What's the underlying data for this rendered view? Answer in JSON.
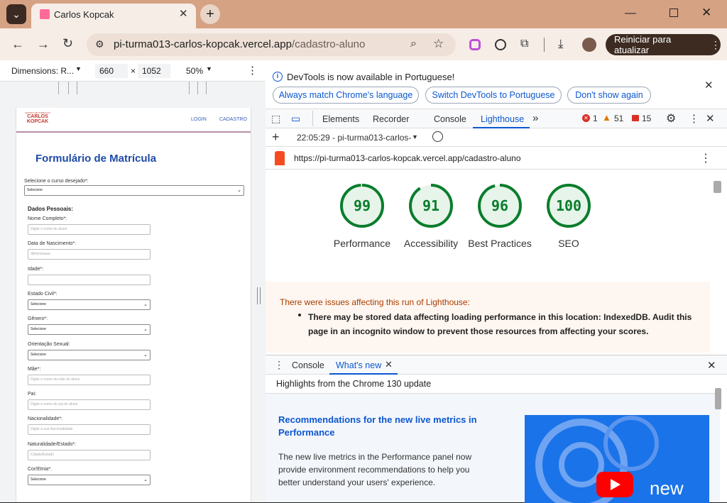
{
  "browser": {
    "tab_title": "Carlos Kopcak",
    "url_host": "pi-turma013-carlos-kopcak.vercel.app",
    "url_path": "/cadastro-aluno",
    "update_button": "Reiniciar para atualizar",
    "accent": "#d6a284"
  },
  "device_toolbar": {
    "dimensions_label": "Dimensions: R...",
    "width": "660",
    "times": "×",
    "height": "1052",
    "zoom": "50%"
  },
  "site": {
    "logo_line1": "CENTRO DE FORMAÇÃO",
    "logo_line2": "CARLOS",
    "logo_line3": "KOPCAK",
    "nav_login": "LOGIN",
    "nav_cadastro": "CADASTRO",
    "form_title": "Formulário de Matrícula",
    "course_label": "Selecione o curso desejado*:",
    "course_value": "Selecione",
    "section_title": "Dados Pessoais:",
    "fields": [
      {
        "label": "Nome Completo*:",
        "kind": "input",
        "value": "Digite o nome do aluno"
      },
      {
        "label": "Data de Nascimento*:",
        "kind": "input",
        "value": "dd/mm/aaaa"
      },
      {
        "label": "Idade*:",
        "kind": "input",
        "value": ""
      },
      {
        "label": "Estado Civil*:",
        "kind": "select",
        "value": "Selecione"
      },
      {
        "label": "Gênero*:",
        "kind": "select",
        "value": "Selecione"
      },
      {
        "label": "Orientação Sexual:",
        "kind": "select",
        "value": "Selecione"
      },
      {
        "label": "Mãe*:",
        "kind": "input",
        "value": "Digite o nome da mãe do aluno"
      },
      {
        "label": "Pai:",
        "kind": "input",
        "value": "Digite o nome do pai do aluno"
      },
      {
        "label": "Nacionalidade*:",
        "kind": "input",
        "value": "Digite a sua Nacionalidade"
      },
      {
        "label": "Naturalidade/Estado*:",
        "kind": "input",
        "value": "Cidade/Estado"
      },
      {
        "label": "Cor/Etnia*:",
        "kind": "select",
        "value": "Selecione"
      }
    ]
  },
  "devtools": {
    "banner_text": "DevTools is now available in Portuguese!",
    "banner_btn1": "Always match Chrome's language",
    "banner_btn2": "Switch DevTools to Portuguese",
    "banner_btn3": "Don't show again",
    "tabs": [
      "Elements",
      "Recorder",
      "Console",
      "Lighthouse"
    ],
    "active_tab": "Lighthouse",
    "errors": "1",
    "warnings": "51",
    "issues": "15",
    "report_time": "22:05:29 - pi-turma013-carlos-",
    "report_url": "https://pi-turma013-carlos-kopcak.vercel.app/cadastro-aluno",
    "scores": [
      {
        "value": 99,
        "label": "Performance"
      },
      {
        "value": 91,
        "label": "Accessibility"
      },
      {
        "value": 96,
        "label": "Best Practices"
      },
      {
        "value": 100,
        "label": "SEO"
      }
    ],
    "warning_title": "There were issues affecting this run of Lighthouse:",
    "warning_item": "There may be stored data affecting loading performance in this location: IndexedDB. Audit this page in an incognito window to prevent those resources from affecting your scores.",
    "drawer_tab1": "Console",
    "drawer_tab2": "What's new",
    "highlights": "Highlights from the Chrome 130 update",
    "article_title": "Recommendations for the new live metrics in Performance",
    "article_body": "The new live metrics in the Performance panel now provide environment recommendations to help you better understand your users' experience.",
    "thumb_text": "new",
    "score_color": "#0a7d2c"
  }
}
